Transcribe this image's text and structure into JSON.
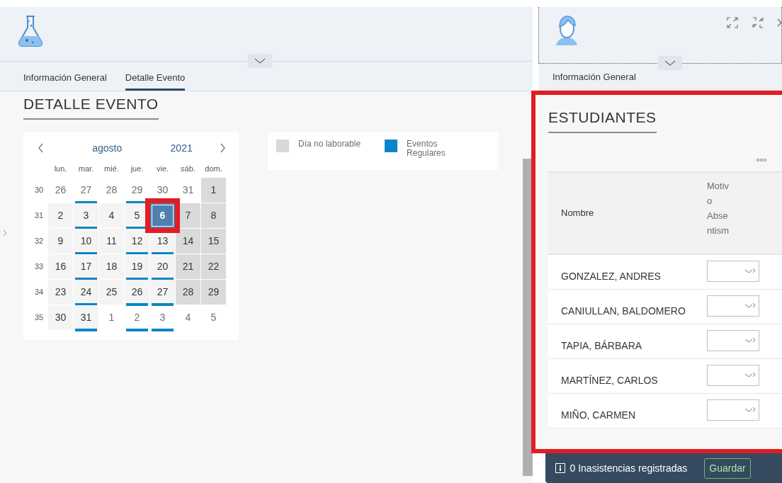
{
  "left_panel": {
    "tabs": [
      {
        "label": "Información General",
        "selected": false
      },
      {
        "label": "Detalle Evento",
        "selected": true
      }
    ],
    "section_title": "DETALLE EVENTO",
    "calendar": {
      "month": "agosto",
      "year": "2021",
      "weekdays": [
        "lun.",
        "mar.",
        "mié.",
        "jue.",
        "vie.",
        "sáb.",
        "dom."
      ],
      "weeks": [
        {
          "number": "30",
          "days": [
            {
              "day": "26",
              "other_month": true,
              "non_working": false,
              "event": false,
              "selected": false,
              "highlighted": false
            },
            {
              "day": "27",
              "other_month": true,
              "non_working": false,
              "event": true,
              "selected": false,
              "highlighted": false
            },
            {
              "day": "28",
              "other_month": true,
              "non_working": false,
              "event": false,
              "selected": false,
              "highlighted": false
            },
            {
              "day": "29",
              "other_month": true,
              "non_working": false,
              "event": true,
              "selected": false,
              "highlighted": false
            },
            {
              "day": "30",
              "other_month": true,
              "non_working": false,
              "event": false,
              "selected": false,
              "highlighted": false
            },
            {
              "day": "31",
              "other_month": true,
              "non_working": false,
              "event": false,
              "selected": false,
              "highlighted": false
            },
            {
              "day": "1",
              "other_month": false,
              "non_working": true,
              "event": false,
              "selected": false,
              "highlighted": false
            }
          ]
        },
        {
          "number": "31",
          "days": [
            {
              "day": "2",
              "other_month": false,
              "non_working": false,
              "event": false,
              "selected": false,
              "highlighted": false
            },
            {
              "day": "3",
              "other_month": false,
              "non_working": false,
              "event": true,
              "selected": false,
              "highlighted": false
            },
            {
              "day": "4",
              "other_month": false,
              "non_working": false,
              "event": false,
              "selected": false,
              "highlighted": false
            },
            {
              "day": "5",
              "other_month": false,
              "non_working": false,
              "event": true,
              "selected": false,
              "highlighted": false
            },
            {
              "day": "6",
              "other_month": false,
              "non_working": false,
              "event": false,
              "selected": true,
              "highlighted": true
            },
            {
              "day": "7",
              "other_month": false,
              "non_working": true,
              "event": false,
              "selected": false,
              "highlighted": false
            },
            {
              "day": "8",
              "other_month": false,
              "non_working": true,
              "event": false,
              "selected": false,
              "highlighted": false
            }
          ]
        },
        {
          "number": "32",
          "days": [
            {
              "day": "9",
              "other_month": false,
              "non_working": false,
              "event": false,
              "selected": false,
              "highlighted": false
            },
            {
              "day": "10",
              "other_month": false,
              "non_working": false,
              "event": true,
              "selected": false,
              "highlighted": false
            },
            {
              "day": "11",
              "other_month": false,
              "non_working": false,
              "event": false,
              "selected": false,
              "highlighted": false
            },
            {
              "day": "12",
              "other_month": false,
              "non_working": false,
              "event": true,
              "selected": false,
              "highlighted": false
            },
            {
              "day": "13",
              "other_month": false,
              "non_working": false,
              "event": true,
              "selected": false,
              "highlighted": false
            },
            {
              "day": "14",
              "other_month": false,
              "non_working": true,
              "event": false,
              "selected": false,
              "highlighted": false
            },
            {
              "day": "15",
              "other_month": false,
              "non_working": true,
              "event": false,
              "selected": false,
              "highlighted": false
            }
          ]
        },
        {
          "number": "33",
          "days": [
            {
              "day": "16",
              "other_month": false,
              "non_working": false,
              "event": false,
              "selected": false,
              "highlighted": false
            },
            {
              "day": "17",
              "other_month": false,
              "non_working": false,
              "event": true,
              "selected": false,
              "highlighted": false
            },
            {
              "day": "18",
              "other_month": false,
              "non_working": false,
              "event": false,
              "selected": false,
              "highlighted": false
            },
            {
              "day": "19",
              "other_month": false,
              "non_working": false,
              "event": true,
              "selected": false,
              "highlighted": false
            },
            {
              "day": "20",
              "other_month": false,
              "non_working": false,
              "event": true,
              "selected": false,
              "highlighted": false
            },
            {
              "day": "21",
              "other_month": false,
              "non_working": true,
              "event": false,
              "selected": false,
              "highlighted": false
            },
            {
              "day": "22",
              "other_month": false,
              "non_working": true,
              "event": false,
              "selected": false,
              "highlighted": false
            }
          ]
        },
        {
          "number": "34",
          "days": [
            {
              "day": "23",
              "other_month": false,
              "non_working": false,
              "event": false,
              "selected": false,
              "highlighted": false
            },
            {
              "day": "24",
              "other_month": false,
              "non_working": false,
              "event": true,
              "selected": false,
              "highlighted": false
            },
            {
              "day": "25",
              "other_month": false,
              "non_working": false,
              "event": false,
              "selected": false,
              "highlighted": false
            },
            {
              "day": "26",
              "other_month": false,
              "non_working": false,
              "event": true,
              "selected": false,
              "highlighted": false
            },
            {
              "day": "27",
              "other_month": false,
              "non_working": false,
              "event": true,
              "selected": false,
              "highlighted": false
            },
            {
              "day": "28",
              "other_month": false,
              "non_working": true,
              "event": false,
              "selected": false,
              "highlighted": false
            },
            {
              "day": "29",
              "other_month": false,
              "non_working": true,
              "event": false,
              "selected": false,
              "highlighted": false
            }
          ]
        },
        {
          "number": "35",
          "days": [
            {
              "day": "30",
              "other_month": false,
              "non_working": false,
              "event": false,
              "selected": false,
              "highlighted": false
            },
            {
              "day": "31",
              "other_month": false,
              "non_working": false,
              "event": true,
              "selected": false,
              "highlighted": false
            },
            {
              "day": "1",
              "other_month": true,
              "non_working": false,
              "event": false,
              "selected": false,
              "highlighted": false
            },
            {
              "day": "2",
              "other_month": true,
              "non_working": false,
              "event": true,
              "selected": false,
              "highlighted": false
            },
            {
              "day": "3",
              "other_month": true,
              "non_working": false,
              "event": true,
              "selected": false,
              "highlighted": false
            },
            {
              "day": "4",
              "other_month": true,
              "non_working": false,
              "event": false,
              "selected": false,
              "highlighted": false
            },
            {
              "day": "5",
              "other_month": true,
              "non_working": false,
              "event": false,
              "selected": false,
              "highlighted": false
            }
          ]
        }
      ]
    },
    "legend": [
      {
        "label": "Día no laborable",
        "color": "#d9d9d9"
      },
      {
        "label": "Eventos Regulares",
        "color": "#0a86c8"
      }
    ]
  },
  "right_panel": {
    "tabs": [
      {
        "label": "Información General",
        "selected": false
      }
    ],
    "highlighted": true,
    "section_title": "ESTUDIANTES",
    "table": {
      "columns": [
        "Nombre",
        "Motivo Absentism"
      ],
      "rows": [
        {
          "name": "GONZALEZ, ANDRES"
        },
        {
          "name": "CANIULLAN, BALDOMERO"
        },
        {
          "name": "TAPIA, BÁRBARA"
        },
        {
          "name": "MARTÍNEZ, CARLOS"
        },
        {
          "name": "MIÑO, CARMEN"
        }
      ]
    },
    "footer": {
      "message": "0 Inasistencias registradas",
      "save_button": "Guardar"
    }
  }
}
